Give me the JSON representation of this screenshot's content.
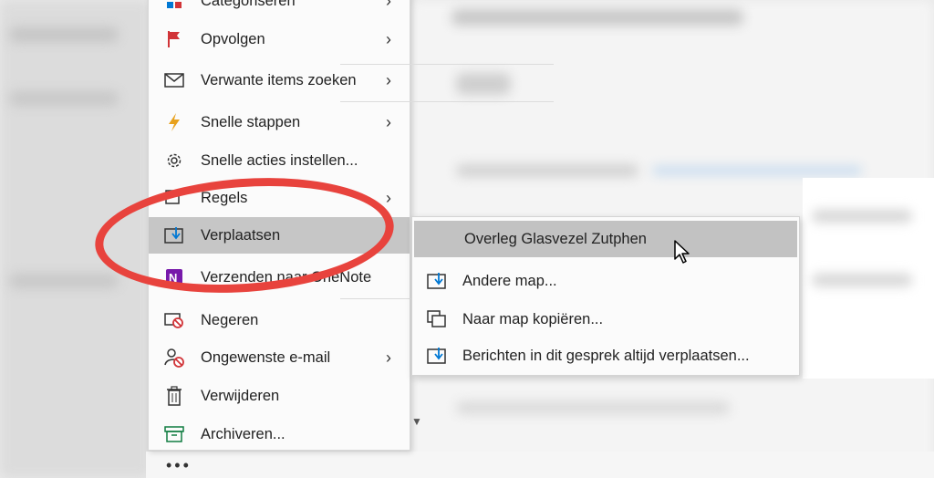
{
  "context_menu": {
    "items": [
      {
        "label": "Categoriseren",
        "icon": "category-icon",
        "has_submenu": true
      },
      {
        "label": "Opvolgen",
        "icon": "flag-icon",
        "has_submenu": true
      },
      {
        "label": "Verwante items zoeken",
        "icon": "envelope-icon",
        "has_submenu": true
      },
      {
        "label": "Snelle stappen",
        "icon": "lightning-icon",
        "has_submenu": true
      },
      {
        "label": "Snelle acties instellen...",
        "icon": "gear-icon",
        "has_submenu": false
      },
      {
        "label": "Regels",
        "icon": "rules-icon",
        "has_submenu": true
      },
      {
        "label": "Verplaatsen",
        "icon": "move-icon",
        "has_submenu": true,
        "highlighted": true
      },
      {
        "label": "Verzenden naar OneNote",
        "icon": "onenote-icon",
        "has_submenu": false
      },
      {
        "label": "Negeren",
        "icon": "ignore-icon",
        "has_submenu": false
      },
      {
        "label": "Ongewenste e-mail",
        "icon": "junk-icon",
        "has_submenu": true
      },
      {
        "label": "Verwijderen",
        "icon": "trash-icon",
        "has_submenu": false
      },
      {
        "label": "Archiveren...",
        "icon": "archive-icon",
        "has_submenu": false
      }
    ],
    "more_label": "•••"
  },
  "submenu": {
    "items": [
      {
        "label": "Overleg Glasvezel Zutphen",
        "highlighted": true
      },
      {
        "label": "Andere map...",
        "icon": "move-icon"
      },
      {
        "label": "Naar map kopiëren...",
        "icon": "copy-icon"
      },
      {
        "label": "Berichten in dit gesprek altijd verplaatsen...",
        "icon": "move-icon"
      }
    ]
  },
  "colors": {
    "highlight": "#c6c6c6",
    "annotation_ring": "#e8433d",
    "flag": "#d13438",
    "lightning": "#e8a11c",
    "onenote": "#7719aa",
    "ignore": "#d13438",
    "archive": "#107c41"
  }
}
